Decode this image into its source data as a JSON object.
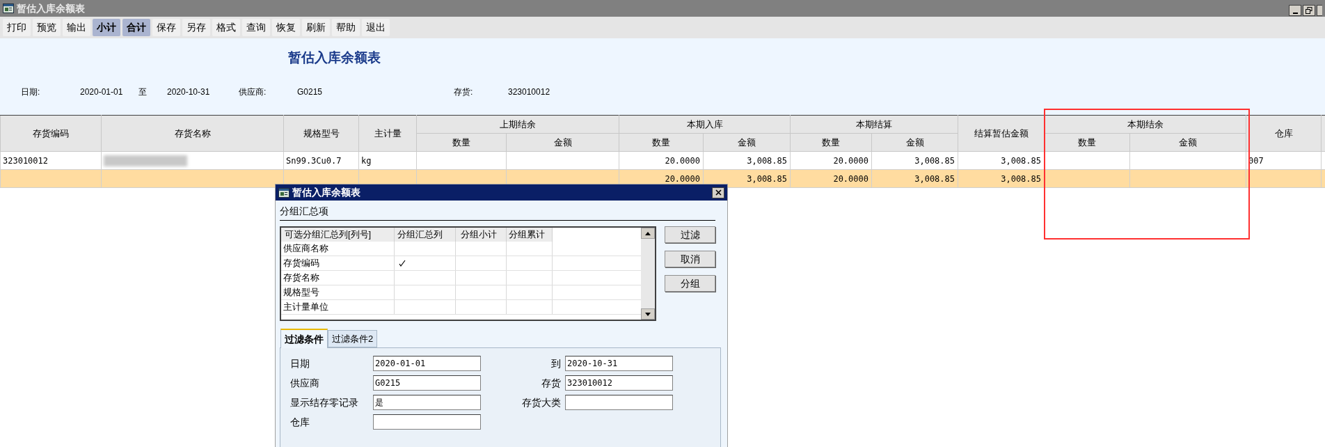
{
  "window": {
    "title": "暂估入库余额表"
  },
  "toolbar": [
    {
      "label": "打印",
      "pressed": false
    },
    {
      "label": "预览",
      "pressed": false
    },
    {
      "label": "输出",
      "pressed": false
    },
    {
      "label": "小计",
      "pressed": true
    },
    {
      "label": "合计",
      "pressed": true
    },
    {
      "label": "保存",
      "pressed": false
    },
    {
      "label": "另存",
      "pressed": false
    },
    {
      "label": "格式",
      "pressed": false
    },
    {
      "label": "查询",
      "pressed": false
    },
    {
      "label": "恢复",
      "pressed": false
    },
    {
      "label": "刷新",
      "pressed": false
    },
    {
      "label": "帮助",
      "pressed": false
    },
    {
      "label": "退出",
      "pressed": false
    }
  ],
  "report": {
    "title": "暂估入库余额表",
    "date_label": "日期:",
    "date_from": "2020-01-01",
    "date_to_label": "至",
    "date_to": "2020-10-31",
    "supplier_label": "供应商:",
    "supplier": "G0215",
    "inventory_label": "存货:",
    "inventory": "323010012"
  },
  "table": {
    "columns": [
      {
        "label": "存货编码"
      },
      {
        "label": "存货名称"
      },
      {
        "label": "规格型号"
      },
      {
        "label": "主计量"
      },
      {
        "label": "上期结余",
        "children": [
          {
            "label": "数量"
          },
          {
            "label": "金额"
          }
        ]
      },
      {
        "label": "本期入库",
        "children": [
          {
            "label": "数量"
          },
          {
            "label": "金额"
          }
        ]
      },
      {
        "label": "本期结算",
        "children": [
          {
            "label": "数量"
          },
          {
            "label": "金额"
          }
        ]
      },
      {
        "label": "结算暂估金额"
      },
      {
        "label": "本期结余",
        "children": [
          {
            "label": "数量"
          },
          {
            "label": "金额"
          }
        ]
      },
      {
        "label": "仓库"
      }
    ],
    "rows": [
      {
        "kind": "detail",
        "inventory_code": "323010012",
        "spec": "Sn99.3Cu0.7",
        "unit": "kg",
        "in_qty": "20.0000",
        "in_amount": "3,008.85",
        "settle_qty": "20.0000",
        "settle_amount": "3,008.85",
        "estimate_amount": "3,008.85",
        "warehouse": "007"
      },
      {
        "kind": "total",
        "in_qty": "20.0000",
        "in_amount": "3,008.85",
        "settle_qty": "20.0000",
        "settle_amount": "3,008.85",
        "estimate_amount": "3,008.85"
      }
    ]
  },
  "dialog": {
    "title": "暂估入库余额表",
    "section": "分组汇总项",
    "grid_columns": [
      "可选分组汇总列[列号]",
      "分组汇总列",
      "分组小计",
      "分组累计"
    ],
    "grid_rows": [
      {
        "label": "供应商名称",
        "group_column": false
      },
      {
        "label": "存货编码",
        "group_column": true
      },
      {
        "label": "存货名称",
        "group_column": false
      },
      {
        "label": "规格型号",
        "group_column": false
      },
      {
        "label": "主计量单位",
        "group_column": false
      }
    ],
    "buttons": [
      "过滤",
      "取消",
      "分组"
    ],
    "tabs": [
      {
        "label": "过滤条件",
        "selected": true
      },
      {
        "label": "过滤条件2",
        "selected": false
      }
    ],
    "fields": [
      {
        "label": "日期",
        "value": "2020-01-01"
      },
      {
        "label": "到",
        "value": "2020-10-31"
      },
      {
        "label": "供应商",
        "value": "G0215"
      },
      {
        "label": "存货",
        "value": "323010012"
      },
      {
        "label": "显示结存零记录",
        "value": "是"
      },
      {
        "label": "存货大类"
      },
      {
        "label": "仓库"
      }
    ]
  }
}
